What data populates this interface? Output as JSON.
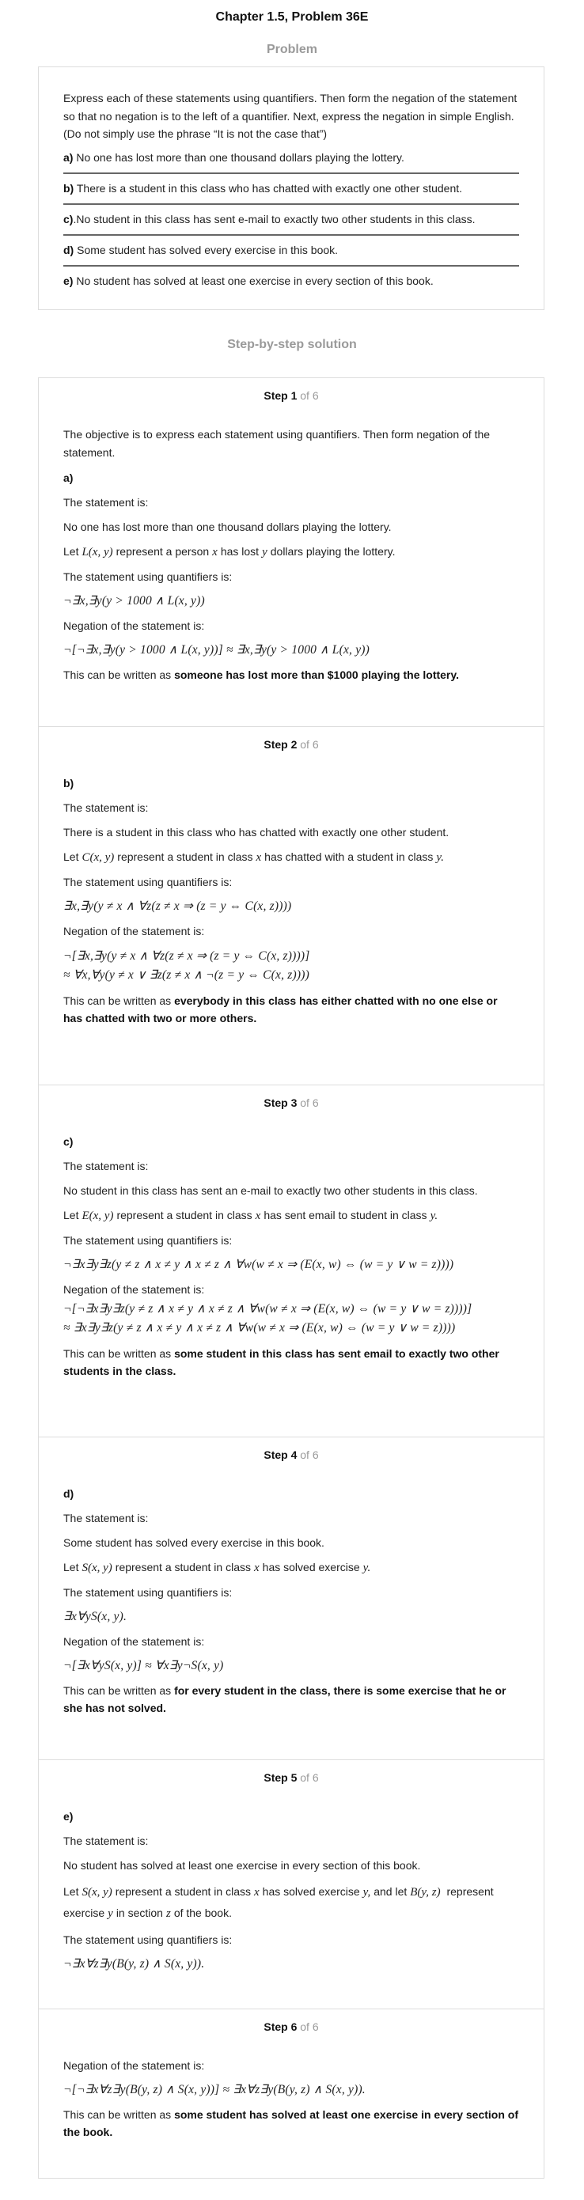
{
  "page_title": "Chapter 1.5, Problem 36E",
  "problem": {
    "heading": "Problem",
    "intro": "Express each of these statements using quantifiers. Then form the negation of the statement so that no negation is to the left of a quantifier. Next, express the negation in simple English. (Do not simply use the phrase “It is not the case that”)",
    "items": [
      {
        "label": "a)",
        "text": " No one has lost more than one thousand dollars playing the lottery."
      },
      {
        "label": "b)",
        "text": " There is a student in this class who has chatted with exactly one other student."
      },
      {
        "label": "c)",
        "text": ".No student in this class has sent e-mail to exactly two other students in this class."
      },
      {
        "label": "d)",
        "text": " Some student has solved every exercise in this book."
      },
      {
        "label": "e)",
        "text": " No student has solved at least one exercise in every section of this book."
      }
    ]
  },
  "solution": {
    "heading": "Step-by-step solution",
    "common": {
      "of": "of 6",
      "statement_is": "The statement is:",
      "using_quantifiers": "The statement using quantifiers is:",
      "negation_is": "Negation of the statement is:",
      "written_as": "This can be written as "
    },
    "steps": [
      {
        "label": "Step 1",
        "intro": "The objective is to express each statement using quantifiers. Then form negation of the statement.",
        "part": "a)",
        "statement": "No one has lost more than one thousand dollars playing the lottery.",
        "let": [
          "Let",
          "L(x, y)",
          "represent a person",
          "x",
          "has lost",
          "y",
          "dollars playing the lottery."
        ],
        "quantified": "¬∃x,∃y(y > 1000 ∧ L(x, y))",
        "negation": [
          "¬[¬∃x,∃y(y > 1000 ∧ L(x, y))] ≈ ∃x,∃y(y > 1000 ∧ L(x, y))"
        ],
        "conclusion": "someone has lost more than $1000 playing the lottery."
      },
      {
        "label": "Step 2",
        "part": "b)",
        "statement": "There is a student in this class who has chatted with exactly one other student.",
        "let": [
          "Let",
          "C(x, y)",
          "represent a student in class",
          "x",
          "has chatted with a student in class",
          "y."
        ],
        "quantified": "∃x,∃y(y ≠ x ∧ ∀z(z ≠ x ⇒ (z = y ⇔ C(x, z))))",
        "negation": [
          "¬[∃x,∃y(y ≠ x ∧ ∀z(z ≠ x ⇒ (z = y ⇔ C(x, z))))]",
          "≈ ∀x,∀y(y ≠ x ∨ ∃z(z ≠ x ∧ ¬(z = y ⇔ C(x, z))))"
        ],
        "conclusion": "everybody in this class has either chatted with no one else or has chatted with two or more others."
      },
      {
        "label": "Step 3",
        "part": "c)",
        "statement": "No student in this class has sent an e-mail to exactly two other students in this class.",
        "let": [
          "Let",
          "E(x, y)",
          "represent a student in class",
          "x",
          "has sent email to student in class",
          "y."
        ],
        "quantified": "¬∃x∃y∃z(y ≠ z ∧ x ≠ y ∧ x ≠ z ∧ ∀w(w ≠ x ⇒ (E(x, w) ⇔ (w = y ∨ w = z))))",
        "negation": [
          "¬[¬∃x∃y∃z(y ≠ z ∧ x ≠ y ∧ x ≠ z ∧ ∀w(w ≠ x ⇒ (E(x, w) ⇔ (w = y ∨ w = z))))]",
          "≈ ∃x∃y∃z(y ≠ z ∧ x ≠ y ∧ x ≠ z ∧ ∀w(w ≠ x ⇒ (E(x, w) ⇔ (w = y ∨ w = z))))"
        ],
        "conclusion": "some student in this class has sent email to exactly two other students in the class."
      },
      {
        "label": "Step 4",
        "part": "d)",
        "statement": "Some student has solved every exercise in this book.",
        "let": [
          "Let",
          "S(x, y)",
          "represent a student in class",
          "x",
          "has solved exercise",
          "y."
        ],
        "quantified": "∃x∀yS(x, y).",
        "negation": [
          "¬[∃x∀yS(x, y)] ≈ ∀x∃y¬S(x, y)"
        ],
        "conclusion": "for every student in the class, there is some exercise that he or she has not solved."
      },
      {
        "label": "Step 5",
        "part": "e)",
        "statement": "No student has solved at least one exercise in every section of this book.",
        "let": [
          "Let",
          "S(x, y)",
          "represent a student in class",
          "x",
          "has solved exercise",
          "y,",
          "and let",
          "B(y, z)",
          "represent exercise",
          "y",
          "in section",
          "z",
          "of the book."
        ],
        "quantified": "¬∃x∀z∃y(B(y, z) ∧ S(x, y))."
      },
      {
        "label": "Step 6",
        "negation": [
          "¬[¬∃x∀z∃y(B(y, z) ∧ S(x, y))] ≈ ∃x∀z∃y(B(y, z) ∧ S(x, y))."
        ],
        "conclusion": "some student has solved at least one exercise in every section of the book."
      }
    ]
  }
}
